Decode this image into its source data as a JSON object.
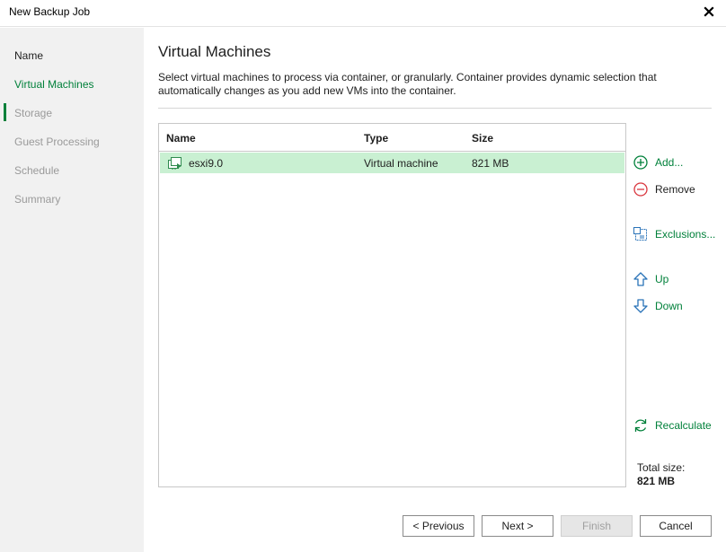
{
  "window": {
    "title": "New Backup Job"
  },
  "sidebar": {
    "steps": [
      {
        "label": "Name",
        "state": "done"
      },
      {
        "label": "Virtual Machines",
        "state": "active"
      },
      {
        "label": "Storage",
        "state": "pending"
      },
      {
        "label": "Guest Processing",
        "state": "pending"
      },
      {
        "label": "Schedule",
        "state": "pending"
      },
      {
        "label": "Summary",
        "state": "pending"
      }
    ]
  },
  "main": {
    "heading": "Virtual Machines",
    "description": "Select virtual machines to process via container, or granularly. Container provides dynamic selection that automatically changes as you add new VMs into the container.",
    "grid": {
      "columns": [
        "Name",
        "Type",
        "Size"
      ],
      "rows": [
        {
          "name": "esxi9.0",
          "type": "Virtual machine",
          "size": "821 MB",
          "icon": "vm-icon",
          "selected": true
        }
      ]
    },
    "actions": {
      "add": {
        "label": "Add...",
        "icon": "add-icon"
      },
      "remove": {
        "label": "Remove",
        "icon": "remove-icon"
      },
      "exclusions": {
        "label": "Exclusions...",
        "icon": "exclusions-icon"
      },
      "up": {
        "label": "Up",
        "icon": "arrow-up-icon"
      },
      "down": {
        "label": "Down",
        "icon": "arrow-down-icon"
      },
      "recalculate": {
        "label": "Recalculate",
        "icon": "recalculate-icon"
      }
    },
    "total": {
      "label": "Total size:",
      "value": "821 MB"
    }
  },
  "footer": {
    "previous": "< Previous",
    "next": "Next >",
    "finish": "Finish",
    "cancel": "Cancel"
  },
  "colors": {
    "accent": "#00803a",
    "selection": "#c9f0d2",
    "remove": "#d9363e",
    "sidebar_bg": "#f1f1f1"
  }
}
